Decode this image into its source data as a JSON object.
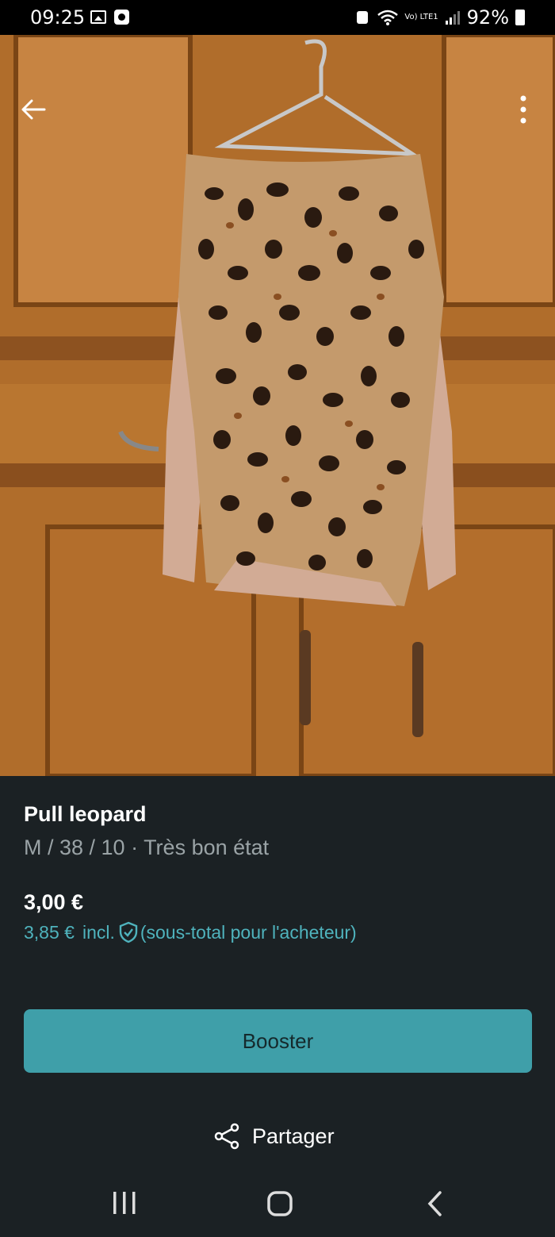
{
  "status_bar": {
    "time": "09:25",
    "network": "Vo) LTE1",
    "battery": "92%"
  },
  "carousel": {
    "total_images": 3,
    "active_index": 0
  },
  "listing": {
    "title": "Pull leopard",
    "details": "M / 38 / 10 · Très bon état",
    "price": "3,00 €",
    "buyer_price": "3,85 €",
    "buyer_incl": "incl.",
    "buyer_note": "(sous-total pour l'acheteur)"
  },
  "actions": {
    "booster_label": "Booster",
    "share_label": "Partager"
  },
  "colors": {
    "background": "#1b2124",
    "accent": "#3f9fa9",
    "link": "#4fb3bd",
    "muted_text": "#9aa3a6"
  },
  "icons": [
    "back-arrow-icon",
    "more-vertical-icon",
    "shield-check-icon",
    "share-icon",
    "nav-recent-icon",
    "nav-home-icon",
    "nav-back-icon"
  ]
}
